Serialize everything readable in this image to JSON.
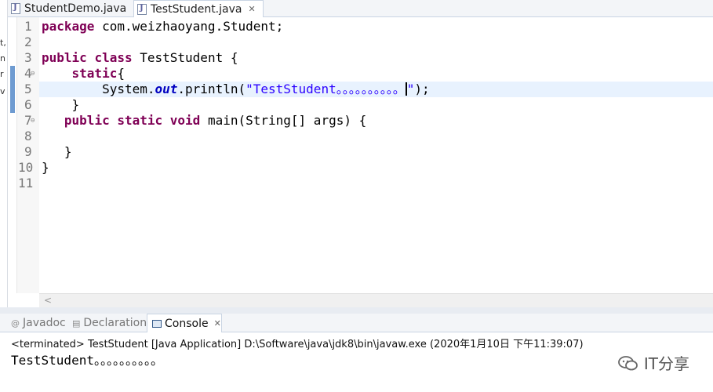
{
  "editor_tabs": [
    {
      "label": "StudentDemo.java"
    },
    {
      "label": "TestStudent.java",
      "close": "✕"
    }
  ],
  "left_strip_glyphs": [
    "t,",
    "n",
    "r",
    "v"
  ],
  "line_numbers": [
    "1",
    "2",
    "3",
    "4",
    "5",
    "6",
    "7",
    "8",
    "9",
    "10",
    "11"
  ],
  "fold_markers": {
    "line4": "⊖",
    "line7": "⊖"
  },
  "code": {
    "l1_kw": "package",
    "l1_rest": " com.weizhaoyang.Student;",
    "l3_kw1": "public",
    "l3_kw2": "class",
    "l3_rest": " TestStudent {",
    "l4_indent": "    ",
    "l4_kw": "static",
    "l4_rest": "{",
    "l5_pre": "        System.",
    "l5_field": "out",
    "l5_mid": ".println(",
    "l5_str_a": "\"TestStudent。。。。。。。。。。",
    "l5_str_b": "\"",
    "l5_post": ");",
    "l6": "    }",
    "l7_indent": "   ",
    "l7_kw1": "public",
    "l7_kw2": "static",
    "l7_kw3": "void",
    "l7_rest": " main(String[] args) {",
    "l9": "   }",
    "l10": "}"
  },
  "panel_tabs": [
    {
      "icon": "@",
      "label": "Javadoc"
    },
    {
      "label": "Declaration"
    },
    {
      "label": "Console",
      "close": "✕"
    }
  ],
  "console": {
    "status": "<terminated> TestStudent [Java Application] D:\\Software\\java\\jdk8\\bin\\javaw.exe (2020年1月10日 下午11:39:07)",
    "output": "TestStudent。。。。。。。。。。"
  },
  "watermark": {
    "text": "IT分享"
  },
  "colors": {
    "keyword": "#7f0055",
    "string": "#2a00ff",
    "field": "#0000c0",
    "current_line": "#e8f2fe"
  }
}
